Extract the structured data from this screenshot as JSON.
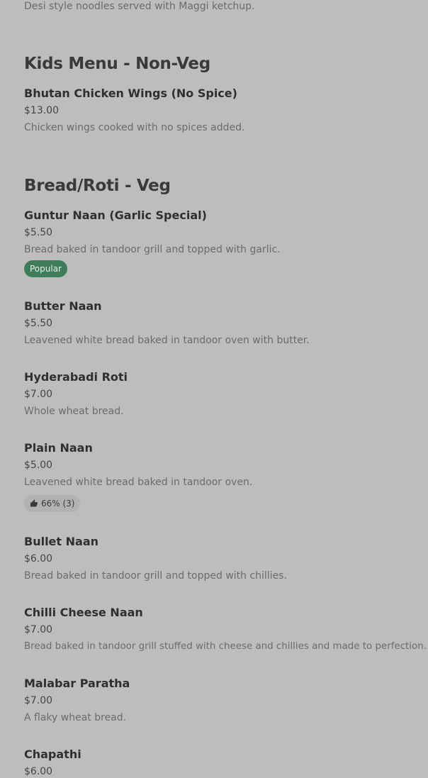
{
  "intro": {
    "description": "Desi style noodles served with Maggi ketchup."
  },
  "sections": [
    {
      "title": "Kids Menu - Non-Veg",
      "items": [
        {
          "name": "Bhutan Chicken Wings (No Spice)",
          "price": "$13.00",
          "description": "Chicken wings cooked with no spices added."
        }
      ]
    },
    {
      "title": "Bread/Roti - Veg",
      "items": [
        {
          "name": "Guntur Naan (Garlic Special)",
          "price": "$5.50",
          "description": "Bread baked in tandoor grill and topped with garlic.",
          "badge": "Popular"
        },
        {
          "name": "Butter Naan",
          "price": "$5.50",
          "description": "Leavened white bread baked in tandoor oven with butter."
        },
        {
          "name": "Hyderabadi Roti",
          "price": "$7.00",
          "description": "Whole wheat bread."
        },
        {
          "name": "Plain Naan",
          "price": "$5.00",
          "description": "Leavened white bread baked in tandoor oven.",
          "rating": "66% (3)",
          "rating_icon": "thumbs-up-icon"
        },
        {
          "name": "Bullet Naan",
          "price": "$6.00",
          "description": "Bread baked in tandoor grill and topped with chillies."
        },
        {
          "name": "Chilli Cheese Naan",
          "price": "$7.00",
          "description": "Bread baked in tandoor grill stuffed with cheese and chillies and made to perfection."
        },
        {
          "name": "Malabar Paratha",
          "price": "$7.00",
          "description": "A flaky wheat bread."
        },
        {
          "name": "Chapathi",
          "price": "$6.00",
          "description": ""
        }
      ]
    }
  ],
  "colors": {
    "background": "#bdbdbd",
    "popular_badge": "#3f7d5a"
  }
}
